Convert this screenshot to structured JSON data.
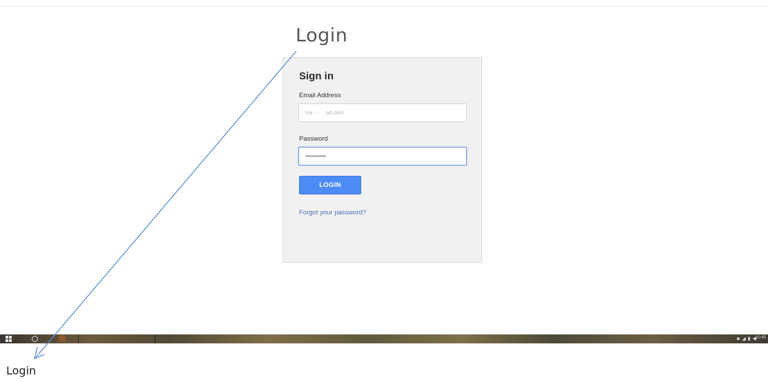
{
  "page": {
    "title": "Login"
  },
  "sign_in": {
    "title": "Sign in",
    "email_label": "Email Address",
    "email_value": "ms · · · ·ail.com",
    "password_label": "Password",
    "password_value": "•••••••••••••",
    "login_button": "LOGIN",
    "forgot_link": "Forgot your password?"
  },
  "taskbar": {
    "tray_icons": "▪◢▮◀",
    "clock": "10:45"
  },
  "annotation": {
    "caption": "Login"
  },
  "colors": {
    "accent": "#4d8cf5",
    "link": "#4a6fb5",
    "card_background": "#f1f1f1",
    "arrow": "#5b8fd6"
  }
}
